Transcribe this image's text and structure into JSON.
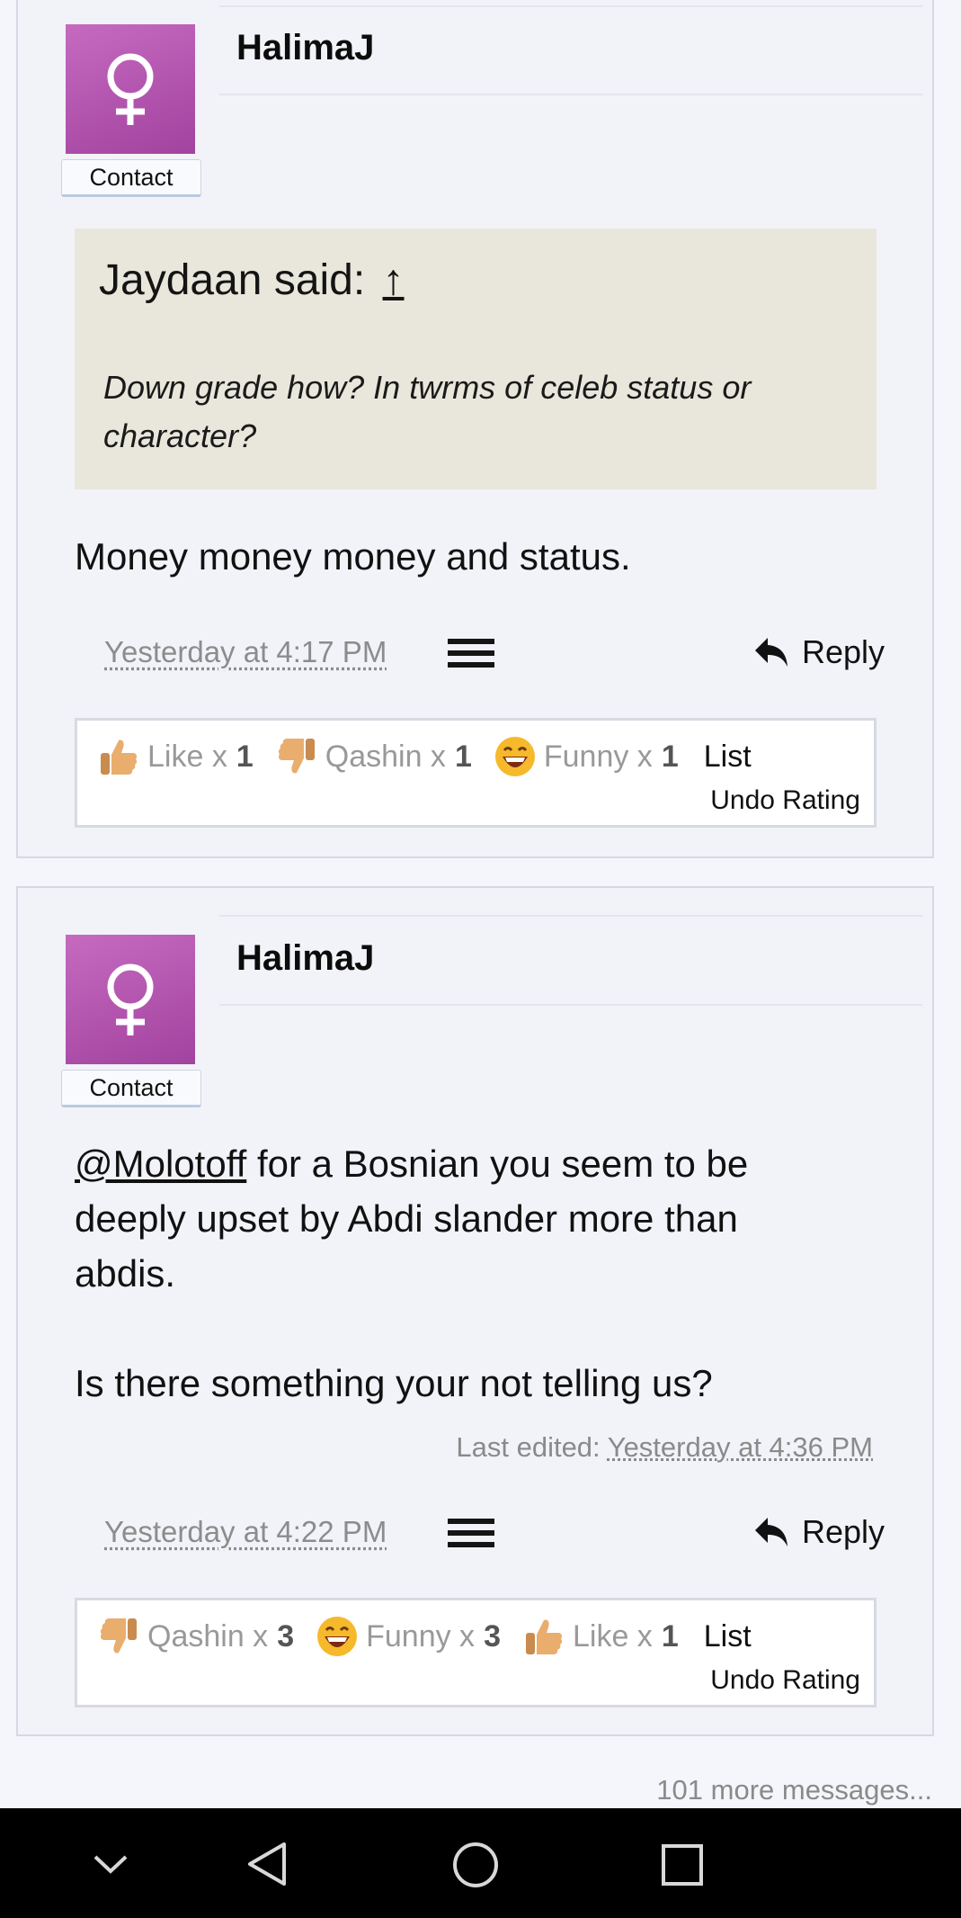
{
  "posts": [
    {
      "username": "HalimaJ",
      "contact_label": "Contact",
      "quote": {
        "author_said": "Jaydaan said:",
        "arrow": "↑",
        "text": "Down grade how? In twrms of celeb status or character?"
      },
      "message": "Money money money and status.",
      "timestamp": "Yesterday at 4:17 PM",
      "reply_label": "Reply",
      "ratings": [
        {
          "icon": "thumbs-up-icon",
          "label": "Like x",
          "count": "1"
        },
        {
          "icon": "thumbs-down-icon",
          "label": "Qashin x",
          "count": "1"
        },
        {
          "icon": "laughing-face-icon",
          "label": "Funny x",
          "count": "1"
        }
      ],
      "list_label": "List",
      "undo_label": "Undo Rating"
    },
    {
      "username": "HalimaJ",
      "contact_label": "Contact",
      "mention": "@Molotoff",
      "message_line1_rest": " for a Bosnian you seem to be deeply upset by Abdi slander more than abdis.",
      "message_line2": "Is there something your not telling us?",
      "last_edited_label": "Last edited:",
      "last_edited_time": "Yesterday at 4:36 PM",
      "timestamp": "Yesterday at 4:22 PM",
      "reply_label": "Reply",
      "ratings": [
        {
          "icon": "thumbs-down-icon",
          "label": "Qashin x",
          "count": "3"
        },
        {
          "icon": "laughing-face-icon",
          "label": "Funny x",
          "count": "3"
        },
        {
          "icon": "thumbs-up-icon",
          "label": "Like x",
          "count": "1"
        }
      ],
      "list_label": "List",
      "undo_label": "Undo Rating"
    }
  ],
  "more_messages": "101 more messages...",
  "colors": {
    "avatar": "#b556b0",
    "quote_bg": "#e9e7db",
    "page_bg": "#f5f6fb",
    "navbar": "#000000"
  },
  "navbar": {
    "buttons": [
      "chevron-down-icon",
      "back-triangle-icon",
      "home-circle-icon",
      "recents-square-icon"
    ]
  }
}
